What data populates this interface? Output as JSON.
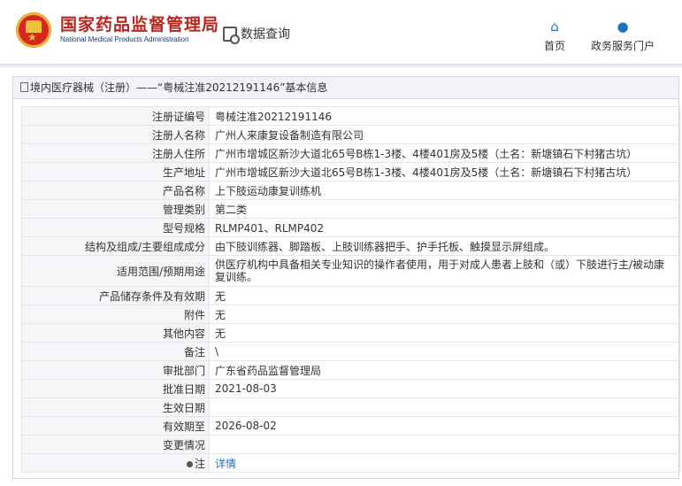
{
  "header": {
    "logo_cn": "国家药品监督管理局",
    "logo_en": "National Medical Products Administration",
    "query_label": "数据查询",
    "nav": [
      {
        "label": "首页",
        "icon": "home-icon"
      },
      {
        "label": "政务服务门户",
        "icon": "user-icon"
      }
    ]
  },
  "panel": {
    "title": "境内医疗器械（注册）——“粤械注准20212191146”基本信息"
  },
  "rows": [
    {
      "key": "注册证编号",
      "value": "粤械注准20212191146"
    },
    {
      "key": "注册人名称",
      "value": "广州人来康复设备制造有限公司"
    },
    {
      "key": "注册人住所",
      "value": "广州市增城区新沙大道北65号B栋1-3楼、4楼401房及5楼（土名：新塘镇石下村猪古坑）"
    },
    {
      "key": "生产地址",
      "value": "广州市增城区新沙大道北65号B栋1-3楼、4楼401房及5楼（土名：新塘镇石下村猪古坑）"
    },
    {
      "key": "产品名称",
      "value": "上下肢运动康复训练机"
    },
    {
      "key": "管理类别",
      "value": "第二类"
    },
    {
      "key": "型号规格",
      "value": "RLMP401、RLMP402"
    },
    {
      "key": "结构及组成/主要组成成分",
      "value": "由下肢训练器、脚踏板、上肢训练器把手、护手托板、触摸显示屏组成。"
    },
    {
      "key": "适用范围/预期用途",
      "value": "供医疗机构中具备相关专业知识的操作者使用，用于对成人患者上肢和（或）下肢进行主/被动康复训练。"
    },
    {
      "key": "产品储存条件及有效期",
      "value": "无"
    },
    {
      "key": "附件",
      "value": "无"
    },
    {
      "key": "其他内容",
      "value": "无"
    },
    {
      "key": "备注",
      "value": "\\"
    },
    {
      "key": "审批部门",
      "value": "广东省药品监督管理局"
    },
    {
      "key": "批准日期",
      "value": "2021-08-03"
    },
    {
      "key": "生效日期",
      "value": ""
    },
    {
      "key": "有效期至",
      "value": "2026-08-02"
    },
    {
      "key": "变更情况",
      "value": ""
    },
    {
      "key": "注",
      "value": "详情"
    }
  ]
}
